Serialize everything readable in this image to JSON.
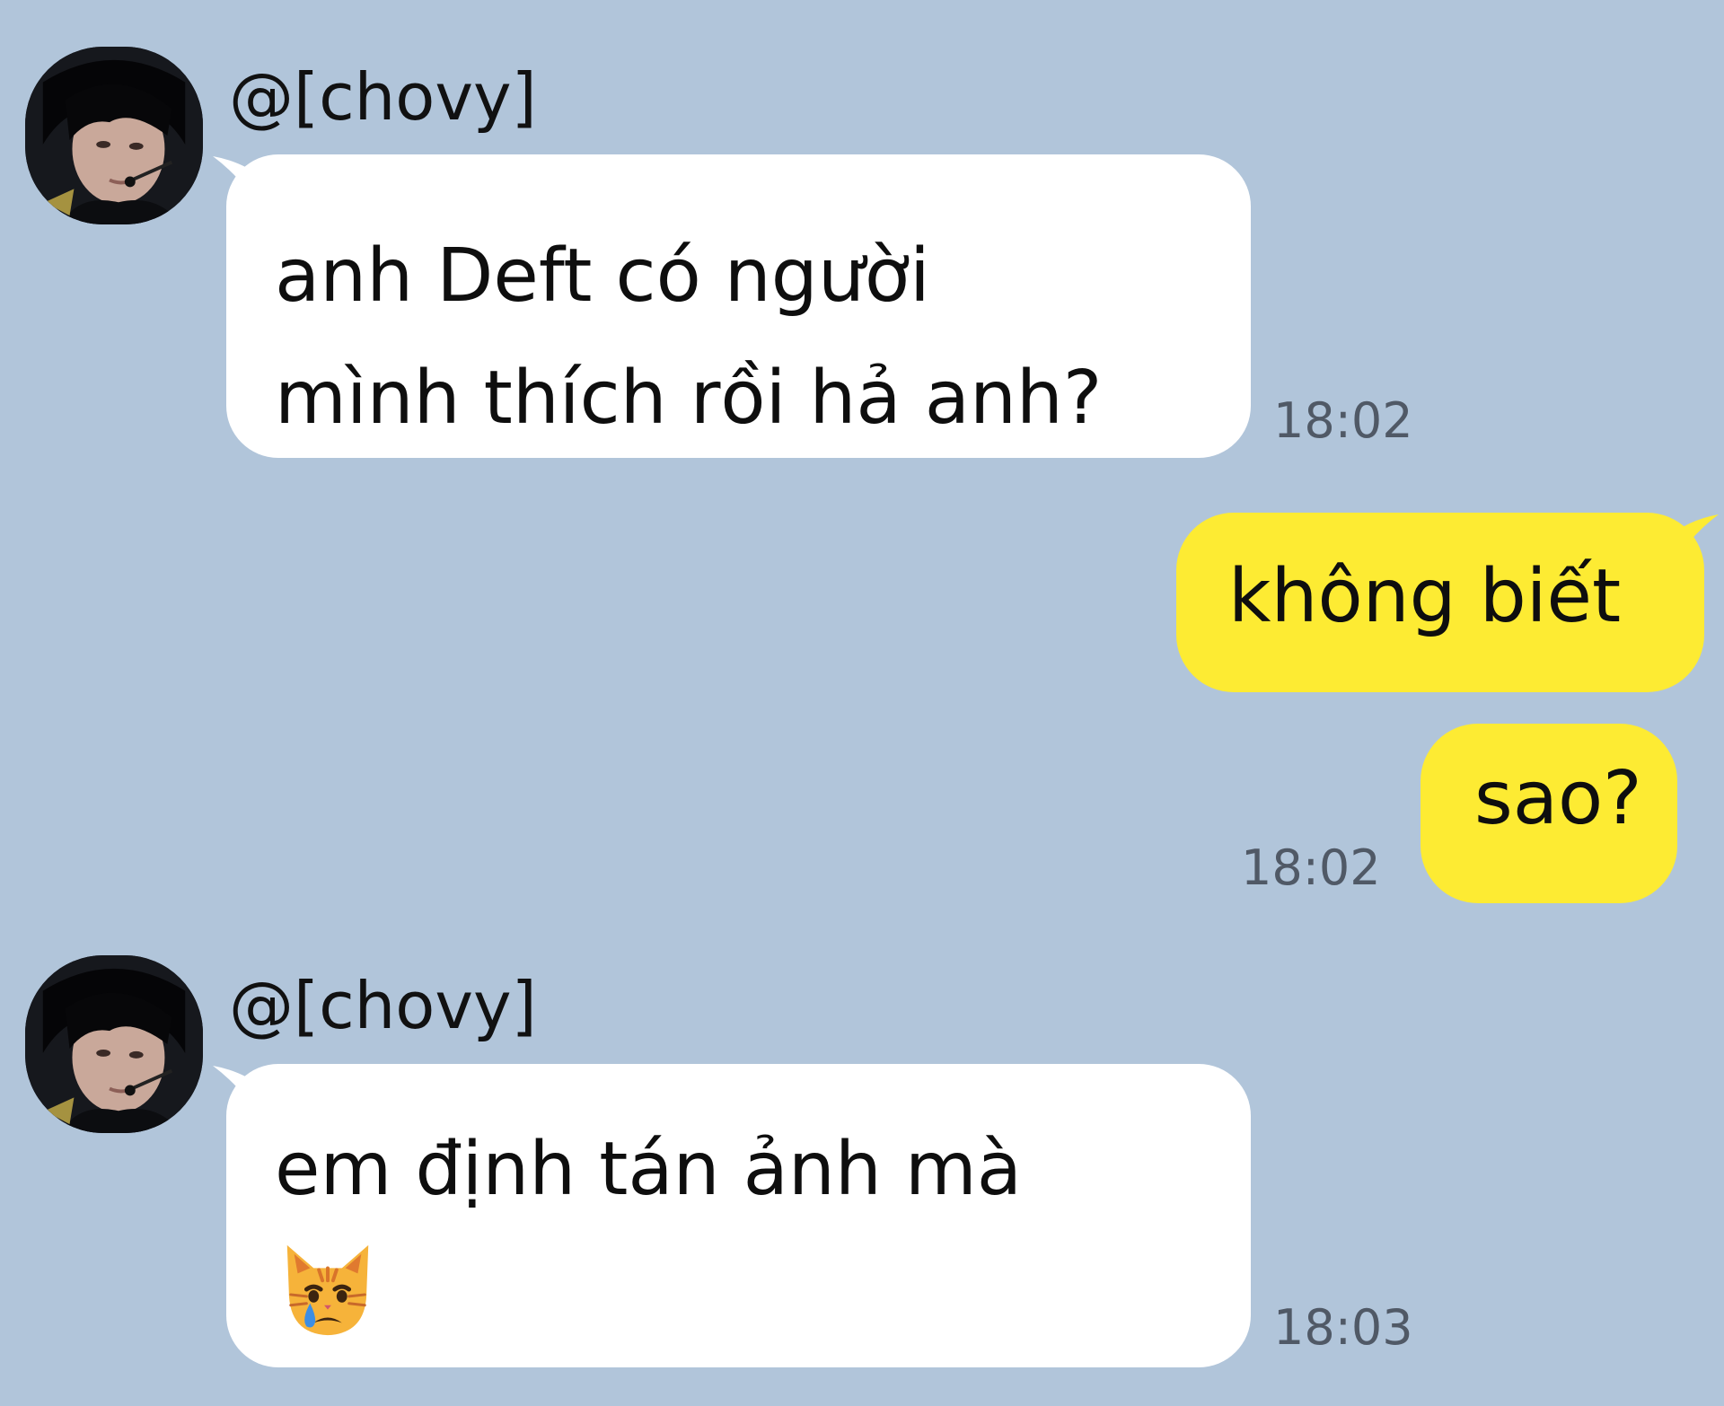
{
  "colors": {
    "background": "#b1c5da",
    "incoming_bubble": "#ffffff",
    "outgoing_bubble": "#fdeb33",
    "timestamp": "#505966"
  },
  "messages": [
    {
      "direction": "incoming",
      "sender": "@[chovy]",
      "lines": [
        "anh Deft có người",
        "mình thích rồi hả anh?"
      ],
      "time": "18:02"
    },
    {
      "direction": "outgoing",
      "lines": [
        "không biết"
      ]
    },
    {
      "direction": "outgoing",
      "lines": [
        "sao?"
      ],
      "time": "18:02"
    },
    {
      "direction": "incoming",
      "sender": "@[chovy]",
      "lines": [
        "em định tán ảnh mà"
      ],
      "emoji": "crying-cat-face",
      "time": "18:03"
    }
  ]
}
